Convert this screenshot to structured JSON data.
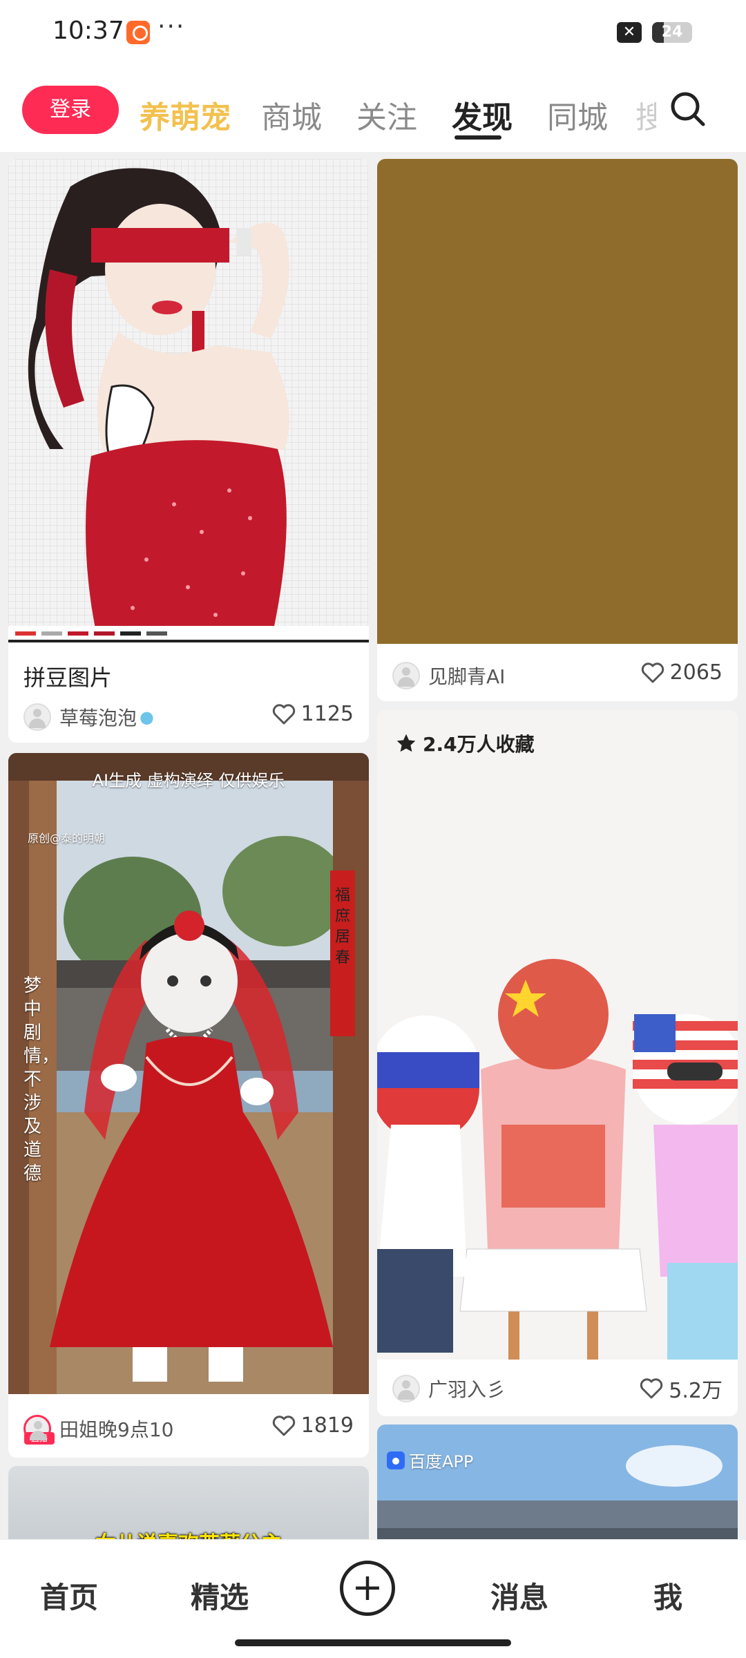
{
  "status_bar": {
    "time": "10:37",
    "dots": "···",
    "close_glyph": "✕",
    "battery": "24"
  },
  "top_nav": {
    "login": "登录",
    "tabs": [
      "养萌宠",
      "商城",
      "关注",
      "发现",
      "同城",
      "搜"
    ],
    "active_tab": "发现"
  },
  "feed": {
    "cards": [
      {
        "title": "拼豆图片",
        "author": "草莓泡泡",
        "likes": "1125"
      },
      {
        "author": "见脚青AI",
        "likes": "2065"
      },
      {
        "overlay_top": "AI生成 虚构演绎 仅供娱乐",
        "watermark": "原创@泰的明朝",
        "vertical_text": "梦中剧情，不涉及道德",
        "scroll_text": "福庶居春",
        "author": "田姐晚9点10",
        "live": "直播",
        "likes": "1819"
      },
      {
        "favorites": "2.4万人收藏",
        "author": "广羽入彡",
        "likes": "5.2万"
      },
      {
        "caption": "女儿说喜欢茉莉公主"
      },
      {
        "brand": "百度APP"
      }
    ]
  },
  "bottom_nav": {
    "items": [
      "首页",
      "精选",
      "消息",
      "我"
    ],
    "plus": "+"
  },
  "colors": {
    "accent": "#fe2c55",
    "pet_tab": "#f2c14e",
    "brown_card": "#8f6c2b"
  }
}
